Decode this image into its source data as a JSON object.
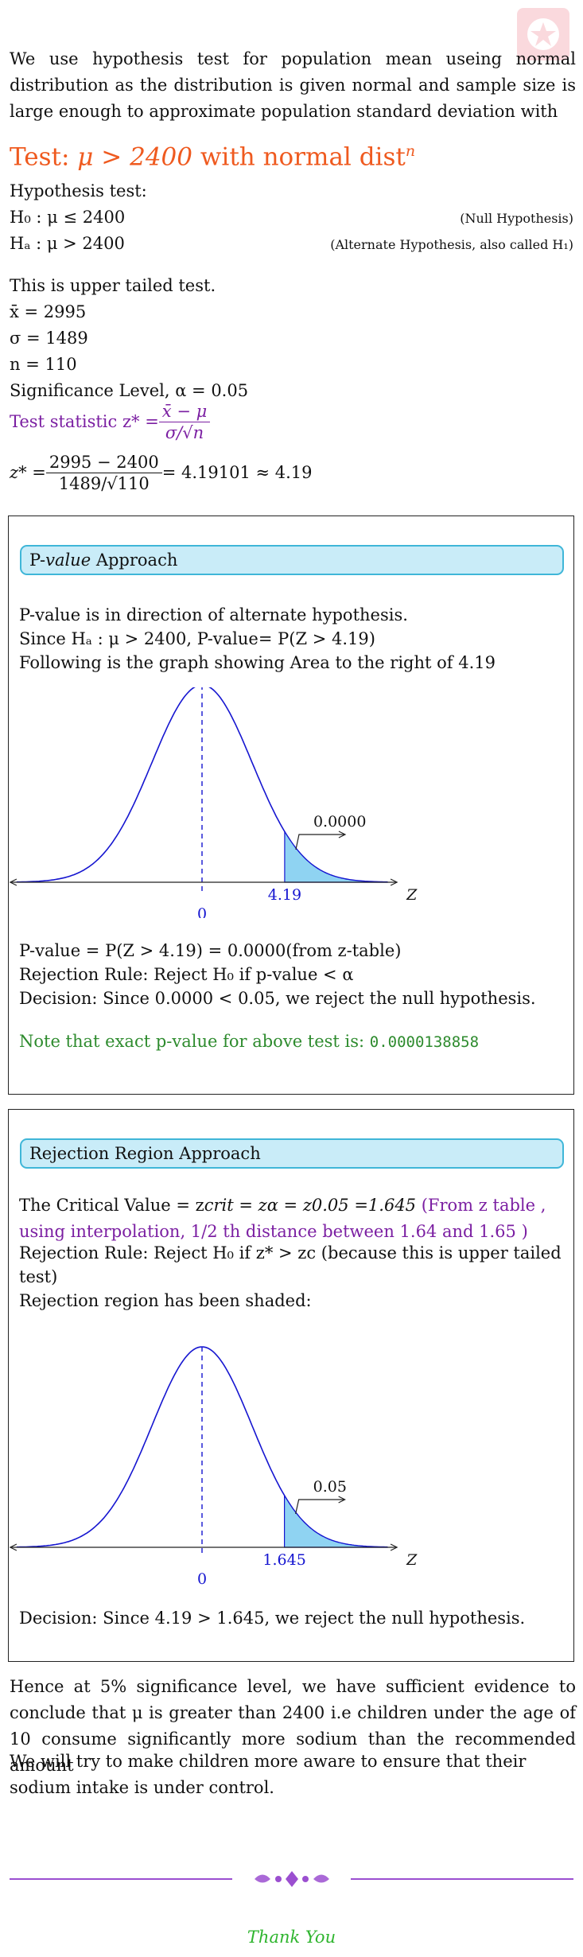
{
  "intro": "We use hypothesis test for population mean useing normal distribution as the distribution is given normal and sample size is large enough to approximate population standard deviation with",
  "test_title": {
    "prefix": "Test: ",
    "math": "μ > 2400",
    "suffix": " with normal dist",
    "sup": "n"
  },
  "hypothesis": {
    "label": "Hypothesis test:",
    "h0": "H₀ : μ ≤ 2400",
    "h0_note": "(Null Hypothesis)",
    "ha": "Hₐ : μ > 2400",
    "ha_note": "(Alternate Hypothesis, also called H₁)"
  },
  "givens": {
    "tail": "This is upper tailed test.",
    "xbar": "x̄ = 2995",
    "sigma": "σ = 1489",
    "n": "n = 110",
    "alpha": "Significance Level, α = 0.05"
  },
  "statistic": {
    "label": "Test statistic z* = ",
    "num": "x̄ − μ",
    "den": "σ/√n",
    "z_lhs": "z* = ",
    "z_num": "2995 − 2400",
    "z_den": "1489/√110",
    "z_rhs": " = 4.19101 ≈ 4.19"
  },
  "pvalue_box": {
    "banner_pre": "P-",
    "banner_em": "value",
    "banner_post": " Approach",
    "line1": "P-value is in direction of alternate hypothesis.",
    "line2": "Since Hₐ : μ > 2400, P-value= P(Z > 4.19)",
    "line3": "Following is the graph showing Area to the right of 4.19",
    "chart_area_label": "0.0000",
    "chart_crit_label": "4.19",
    "chart_zero_label": "0",
    "chart_axis_label": "Z",
    "result": "P-value = P(Z > 4.19) = 0.0000(from z-table)",
    "rule": "Rejection Rule: Reject H₀ if p-value < α",
    "decision": "Decision: Since 0.0000 < 0.05, we reject the null hypothesis.",
    "note_text": "Note that exact p-value for above test is: ",
    "note_value": "0.0000138858"
  },
  "rejection_box": {
    "banner": "Rejection Region Approach",
    "crit_text": "The Critical Value = z",
    "crit_expr": "crit = zα = z0.05 =1.645",
    "crit_note": "(From z table , using interpolation, 1/2 th distance between 1.64 and 1.65 )",
    "rule1": "Rejection Rule: Reject H₀ if z* > zc (because this is upper tailed",
    "rule2": "test)",
    "shaded": "Rejection region has been shaded:",
    "chart_area_label": "0.05",
    "chart_crit_label": "1.645",
    "chart_zero_label": "0",
    "chart_axis_label": "Z",
    "decision": "Decision: Since 4.19 > 1.645, we reject the null hypothesis."
  },
  "conclusion": "Hence at 5% significance level, we have sufficient evidence to conclude that μ is greater than 2400 i.e children under the age of 10 consume significantly more sodium than the recommended amount",
  "closing": "We will try to make children more aware to ensure that their sodium intake is under control.",
  "thank_you": "Thank You",
  "chart_data": [
    {
      "type": "area",
      "distribution": "standard normal",
      "shaded_region": "right of z",
      "critical_z": 4.19,
      "area": "0.0000",
      "x_ticks": [
        "0",
        "4.19"
      ],
      "xlabel": "Z"
    },
    {
      "type": "area",
      "distribution": "standard normal",
      "shaded_region": "right of z",
      "critical_z": 1.645,
      "area": "0.05",
      "x_ticks": [
        "0",
        "1.645"
      ],
      "xlabel": "Z"
    }
  ],
  "colors": {
    "accent": "#ef5a1f",
    "purple": "#7b1fa2",
    "green": "#2e8b2e",
    "curve": "#1515d0",
    "banner_fill": "#c9ecf8",
    "banner_border": "#3fb6d8",
    "shade": "#8fd3f2"
  }
}
